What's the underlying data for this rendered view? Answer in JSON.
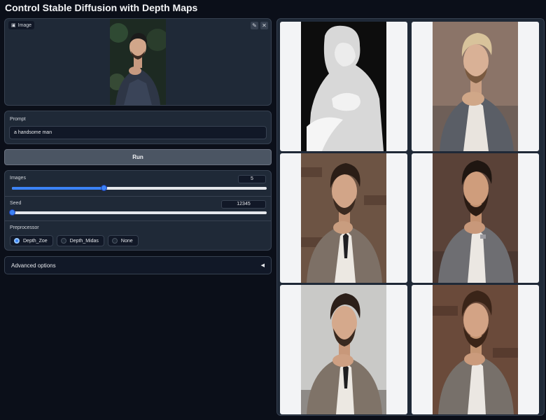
{
  "app": {
    "title": "Control Stable Diffusion with Depth Maps"
  },
  "image_input": {
    "label": "Image",
    "edit_icon": "pencil-icon",
    "close_icon": "close-icon"
  },
  "prompt": {
    "label": "Prompt",
    "value": "a handsome man"
  },
  "run_button": {
    "label": "Run"
  },
  "images_slider": {
    "label": "Images",
    "value": "5",
    "fraction": 0.36
  },
  "seed_slider": {
    "label": "Seed",
    "value": "12345",
    "fraction": 0.0
  },
  "preprocessor": {
    "label": "Preprocessor",
    "options": [
      "Depth_Zoe",
      "Depth_Midas",
      "None"
    ],
    "selected": "Depth_Zoe"
  },
  "advanced": {
    "label": "Advanced options",
    "arrow": "◀"
  },
  "colors": {
    "accent": "#3b82f6",
    "background": "#0b0f19",
    "panel": "#1f2937"
  }
}
